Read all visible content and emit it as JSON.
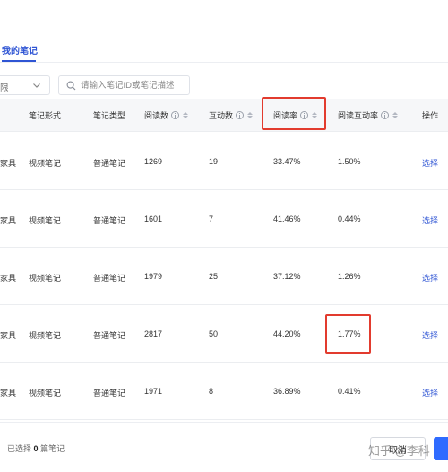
{
  "tabs": {
    "active_label": "我的笔记"
  },
  "filter": {
    "value": "限"
  },
  "search": {
    "placeholder": "请输入笔记ID或笔记描述"
  },
  "table": {
    "columns": [
      "笔记形式",
      "笔记类型",
      "阅读数",
      "互动数",
      "阅读率",
      "阅读互动率",
      "操作"
    ],
    "rows": [
      {
        "name": "家具",
        "form": "视频笔记",
        "type": "普通笔记",
        "reads": "1269",
        "interactions": "19",
        "read_rate": "33.47%",
        "interaction_rate": "1.50%",
        "action": "选择"
      },
      {
        "name": "家具",
        "form": "视频笔记",
        "type": "普通笔记",
        "reads": "1601",
        "interactions": "7",
        "read_rate": "41.46%",
        "interaction_rate": "0.44%",
        "action": "选择"
      },
      {
        "name": "家具",
        "form": "视频笔记",
        "type": "普通笔记",
        "reads": "1979",
        "interactions": "25",
        "read_rate": "37.12%",
        "interaction_rate": "1.26%",
        "action": "选择"
      },
      {
        "name": "家具",
        "form": "视频笔记",
        "type": "普通笔记",
        "reads": "2817",
        "interactions": "50",
        "read_rate": "44.20%",
        "interaction_rate": "1.77%",
        "action": "选择"
      },
      {
        "name": "家具",
        "form": "视频笔记",
        "type": "普通笔记",
        "reads": "1971",
        "interactions": "8",
        "read_rate": "36.89%",
        "interaction_rate": "0.41%",
        "action": "选择"
      }
    ]
  },
  "footer": {
    "selected_prefix": "已选择",
    "selected_count": "0",
    "selected_suffix": "篇笔记",
    "cancel_label": "取消"
  },
  "watermark": "知乎 @李科",
  "colors": {
    "accent": "#2f55d4",
    "highlight": "#e23b2e",
    "primary_button": "#2f6bff"
  }
}
